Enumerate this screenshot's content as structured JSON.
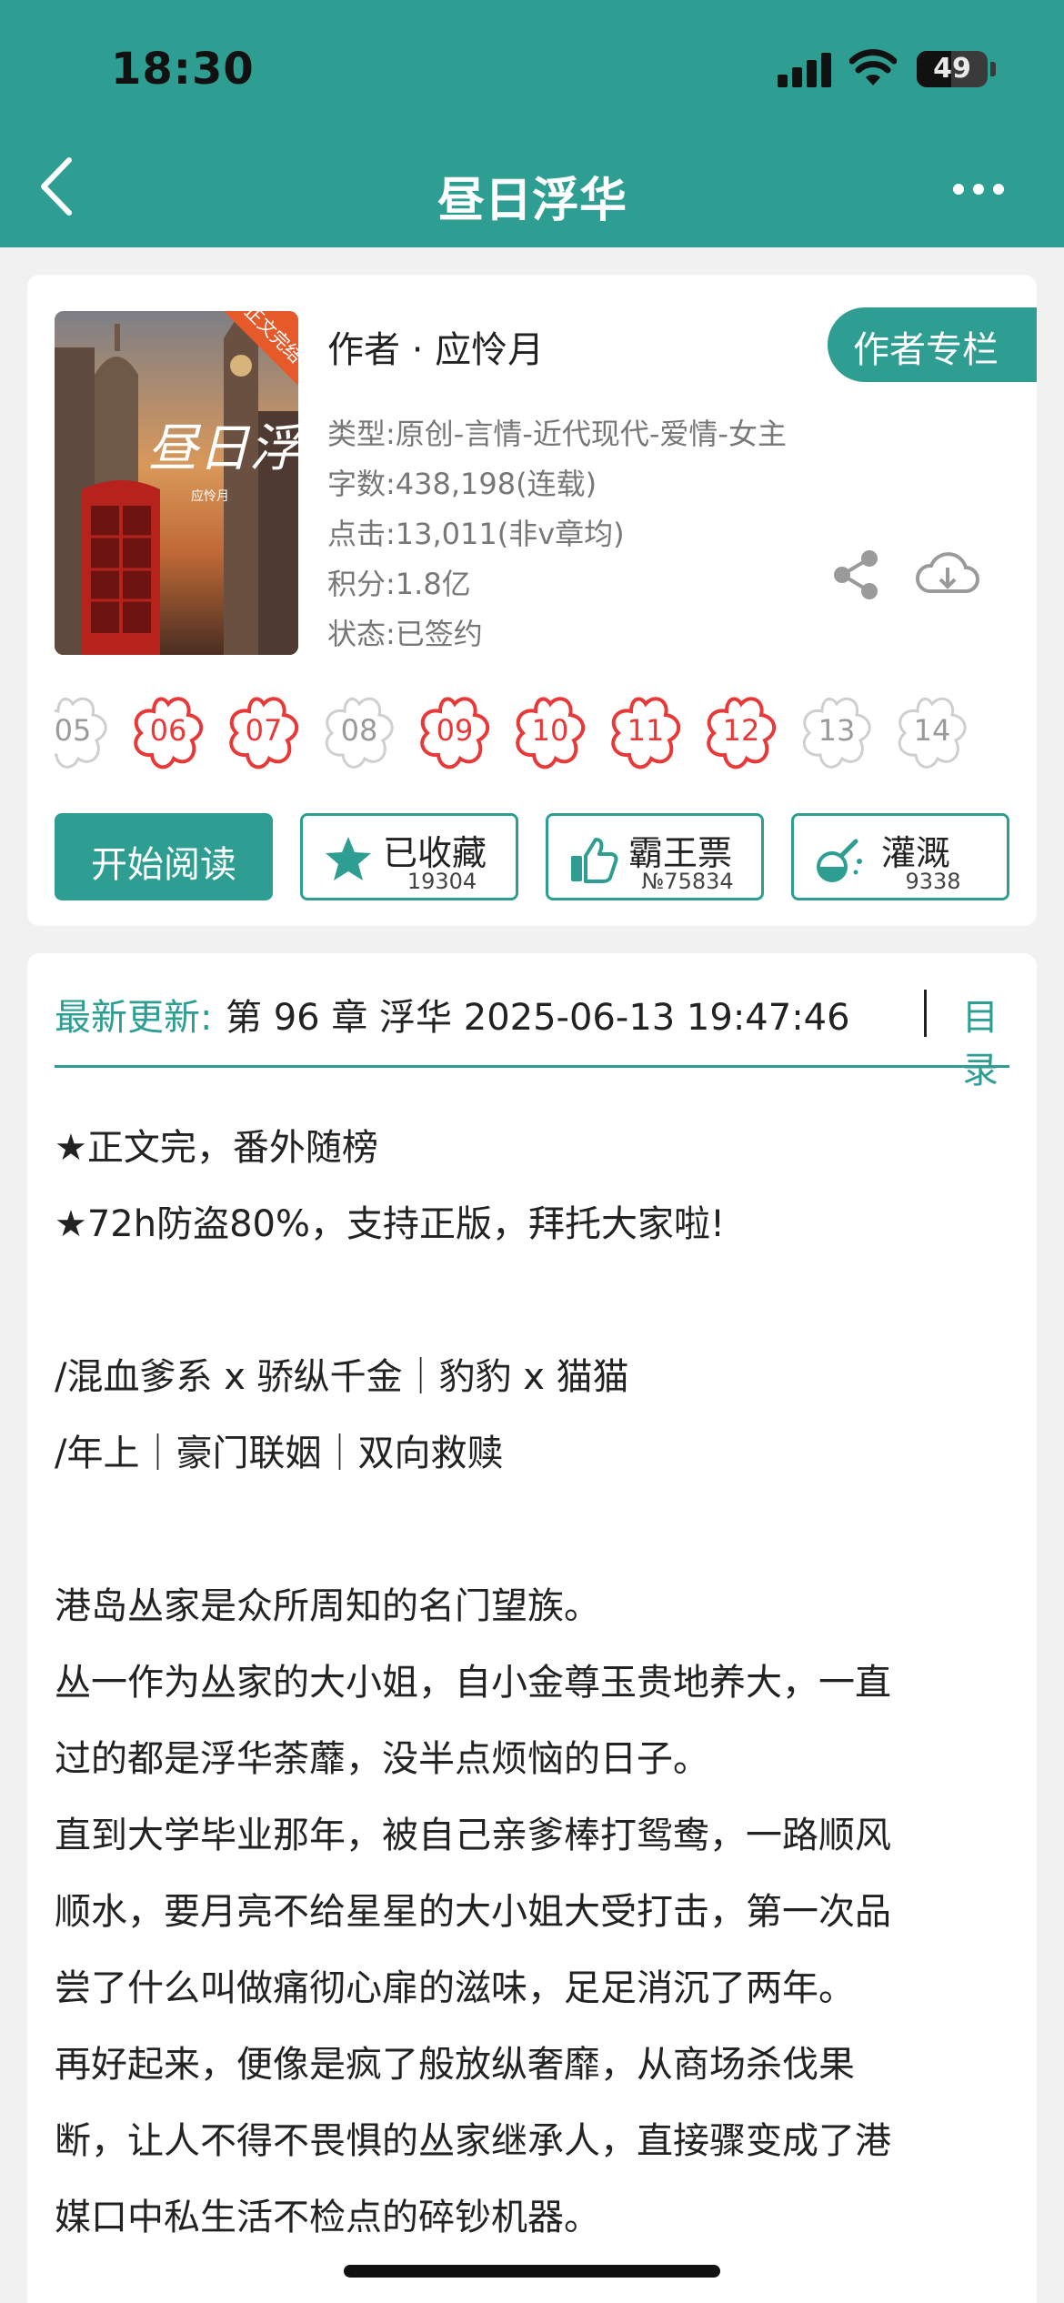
{
  "status_bar": {
    "time": "18:30",
    "battery": "49",
    "battery_level": 0.49
  },
  "header": {
    "title": "昼日浮华"
  },
  "book": {
    "author": "作者 · 应怜月",
    "author_column_label": "作者专栏",
    "meta": [
      "类型:原创-言情-近代现代-爱情-女主",
      "字数:438,198(连载)",
      "点击:13,011(非v章均)",
      "积分:1.8亿",
      "状态:已签约"
    ],
    "cover_badge": "正文完结",
    "cover_title": "昼日浮华",
    "cover_author": "应怜月"
  },
  "flowers": [
    {
      "label": "05",
      "active": false
    },
    {
      "label": "06",
      "active": true
    },
    {
      "label": "07",
      "active": true
    },
    {
      "label": "08",
      "active": false
    },
    {
      "label": "09",
      "active": true
    },
    {
      "label": "10",
      "active": true
    },
    {
      "label": "11",
      "active": true
    },
    {
      "label": "12",
      "active": true
    },
    {
      "label": "13",
      "active": false
    },
    {
      "label": "14",
      "active": false
    }
  ],
  "actions": {
    "start_reading": "开始阅读",
    "favorite": {
      "label": "已收藏",
      "count": "19304"
    },
    "ticket": {
      "label": "霸王票",
      "count": "№75834"
    },
    "nutrient": {
      "label": "灌溉",
      "count": "9338"
    }
  },
  "latest": {
    "label": "最新更新:",
    "value": "第 96 章 浮华 2025-06-13 19:47:46",
    "toc_label": "目录"
  },
  "description": [
    "★正文完，番外随榜",
    "★72h防盗80%，支持正版，拜托大家啦!",
    "",
    "/混血爹系 x 骄纵千金｜豹豹 x 猫猫",
    "/年上｜豪门联姻｜双向救赎",
    "",
    "港岛丛家是众所周知的名门望族。",
    "丛一作为丛家的大小姐，自小金尊玉贵地养大，一直",
    "过的都是浮华荼蘼，没半点烦恼的日子。",
    "直到大学毕业那年，被自己亲爹棒打鸳鸯，一路顺风",
    "顺水，要月亮不给星星的大小姐大受打击，第一次品",
    "尝了什么叫做痛彻心扉的滋味，足足消沉了两年。",
    "再好起来，便像是疯了般放纵奢靡，从商场杀伐果",
    "断，让人不得不畏惧的丛家继承人，直接骤变成了港",
    "媒口中私生活不检点的碎钞机器。"
  ],
  "colors": {
    "accent": "#2f9e92",
    "flower_active": "#e83838",
    "flower_inactive": "#cfcfcf"
  },
  "icons": [
    "back-icon",
    "more-icon",
    "share-icon",
    "download-icon",
    "star-icon",
    "thumbs-up-icon",
    "watering-icon"
  ]
}
